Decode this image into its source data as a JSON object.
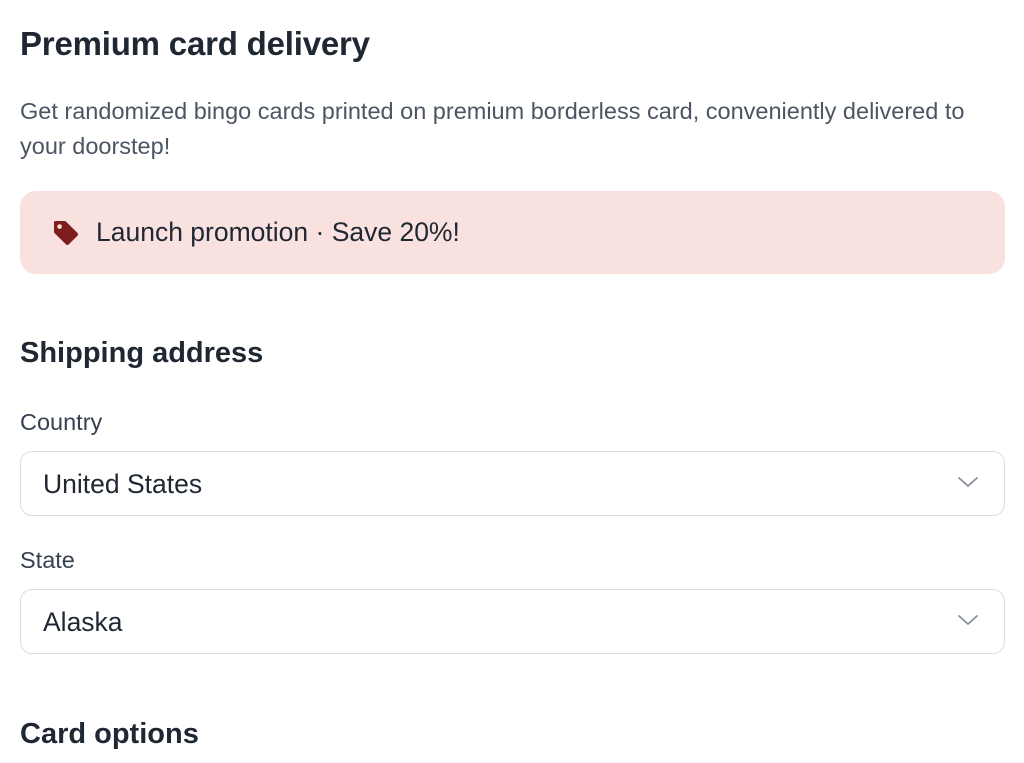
{
  "page": {
    "title": "Premium card delivery",
    "description": "Get randomized bingo cards printed on premium borderless card, conveniently delivered to your doorstep!"
  },
  "promo": {
    "text": "Launch promotion · Save 20%!",
    "icon": "tag-icon",
    "background_color": "#f9e1e0",
    "icon_color": "#7f1d1d"
  },
  "shipping": {
    "heading": "Shipping address",
    "country": {
      "label": "Country",
      "value": "United States"
    },
    "state": {
      "label": "State",
      "value": "Alaska"
    }
  },
  "card_options": {
    "heading": "Card options"
  }
}
